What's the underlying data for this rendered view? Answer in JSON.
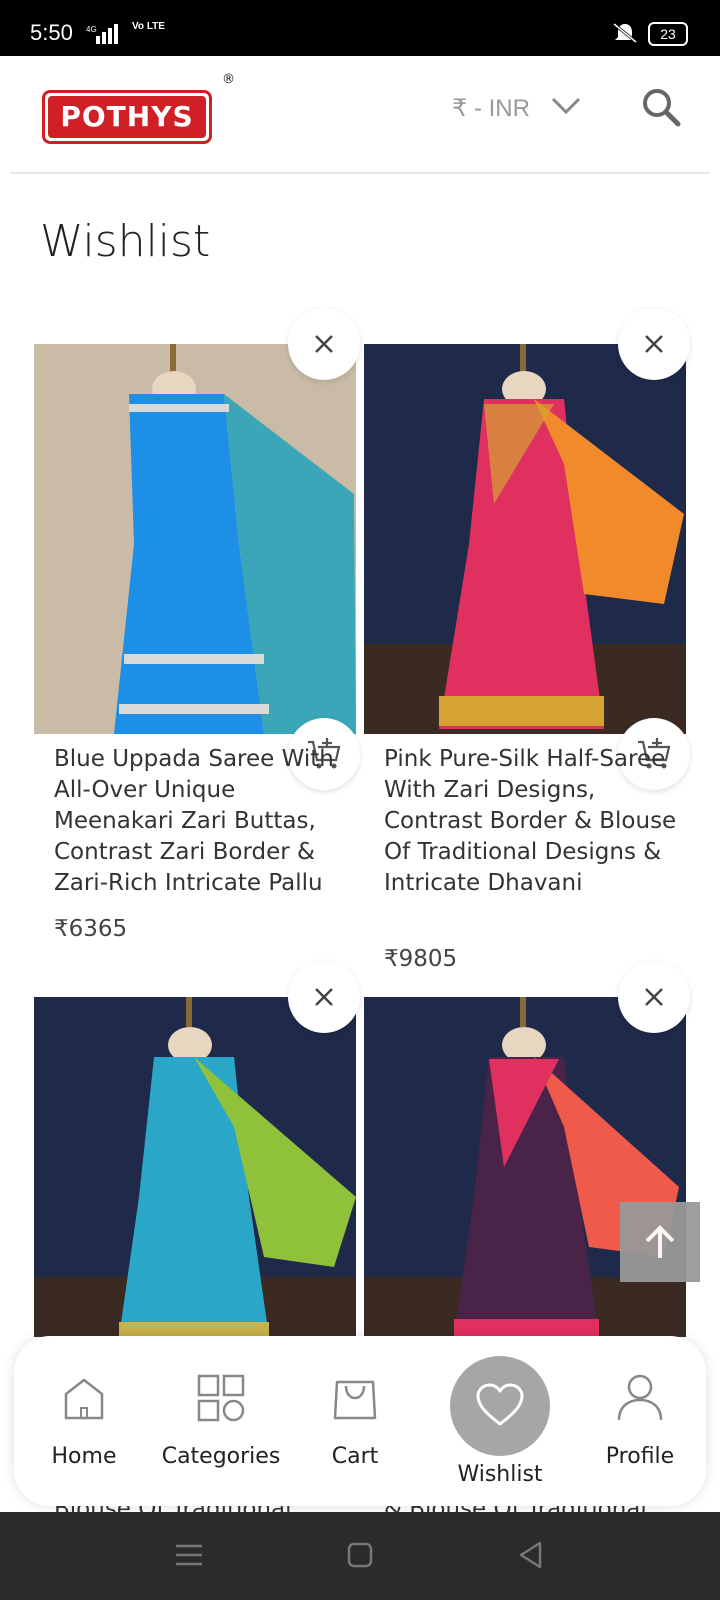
{
  "status_bar": {
    "time": "5:50",
    "network": "4G",
    "volte": "Vo LTE",
    "battery": "23"
  },
  "header": {
    "logo_text": "POTHYS",
    "logo_mark": "®",
    "currency_label": "₹ - INR",
    "icons": {
      "currency_dropdown": "chevron-down-icon",
      "search": "search-icon"
    }
  },
  "page": {
    "title": "Wishlist"
  },
  "products": [
    {
      "title": "Blue Uppada Saree With All-Over Unique Meenakari Zari Buttas, Contrast Zari Border & Zari-Rich Intricate Pallu",
      "price": "₹6365",
      "colors": {
        "bg": "#c9bba5",
        "saree": "#1e8fe6",
        "pallu": "#3aa6b8",
        "border": "#d9d9d9"
      }
    },
    {
      "title": "Pink Pure-Silk Half-Saree With Zari Designs, Contrast Border & Blouse Of Traditional Designs & Intricate Dhavani",
      "price": "₹9805",
      "colors": {
        "bg": "#1f2a4a",
        "saree": "#e0305f",
        "pallu": "#f08a2a",
        "border": "#d6a233"
      }
    },
    {
      "title": "",
      "price": "",
      "colors": {
        "bg": "#1f2a4a",
        "saree": "#2aa6c9",
        "pallu": "#8fc23a",
        "border": "#c9b24a"
      }
    },
    {
      "title": "",
      "price": "",
      "colors": {
        "bg": "#1f2a4a",
        "saree": "#4a2448",
        "pallu": "#f05a4a",
        "border": "#e0305f"
      }
    }
  ],
  "behind_nav_text": [
    "Blouse Of Traditional",
    "& Blouse Of Traditional"
  ],
  "bottom_nav": [
    {
      "label": "Home",
      "icon": "home-icon"
    },
    {
      "label": "Categories",
      "icon": "categories-icon"
    },
    {
      "label": "Cart",
      "icon": "cart-bag-icon"
    },
    {
      "label": "Wishlist",
      "icon": "heart-icon",
      "active": true
    },
    {
      "label": "Profile",
      "icon": "profile-icon"
    }
  ],
  "accent_colors": {
    "brand_red": "#d11f26",
    "active_nav": "#a6a6a6"
  }
}
